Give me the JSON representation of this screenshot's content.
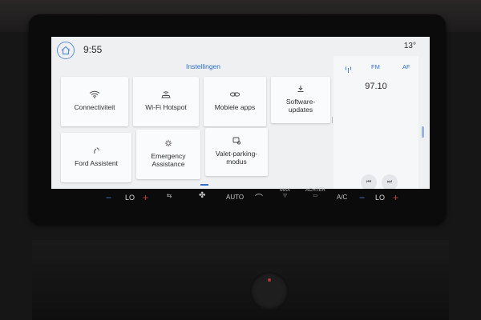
{
  "statusbar": {
    "time": "9:55",
    "temperature": "13°"
  },
  "settings": {
    "title": "Instellingen",
    "tiles": [
      {
        "label": "Connectiviteit",
        "icon": "wifi-icon"
      },
      {
        "label": "Wi-Fi Hotspot",
        "icon": "hotspot-car-icon"
      },
      {
        "label": "Mobiele apps",
        "icon": "link-icon"
      },
      {
        "label_line1": "Software-",
        "label_line2": "updates",
        "icon": "download-icon"
      },
      {
        "label": "Ford Assistent",
        "icon": "assistant-icon"
      },
      {
        "label_line1": "Emergency",
        "label_line2": "Assistance",
        "icon": "emergency-icon"
      },
      {
        "label_line1": "Valet-parking-",
        "label_line2": "modus",
        "icon": "valet-icon"
      }
    ]
  },
  "radio": {
    "band": "FM",
    "af": "AF",
    "frequency": "97.10"
  },
  "climate": {
    "left_temp": "LO",
    "right_temp": "LO",
    "auto": "AUTO",
    "max": "MAX",
    "achter": "ACHTER",
    "ac": "A/C"
  },
  "colors": {
    "accent": "#2f6fd1",
    "screen_bg": "#eef0f2",
    "plus": "#d24343",
    "minus": "#4c7bd4"
  }
}
